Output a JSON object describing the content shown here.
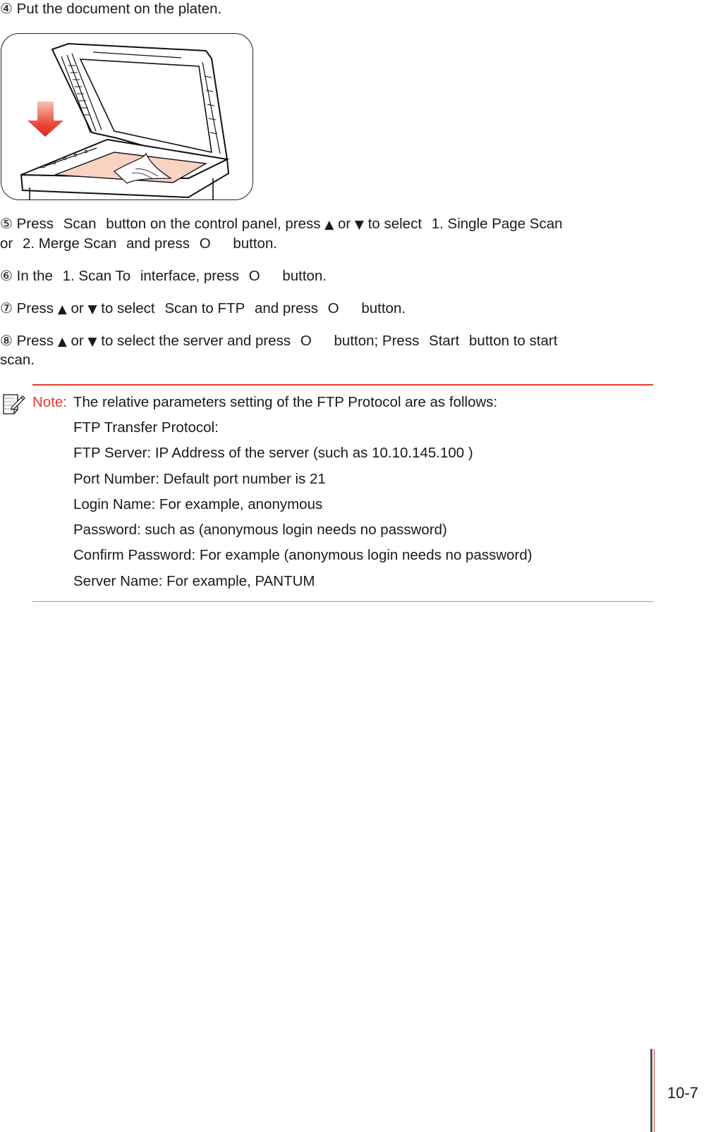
{
  "steps": [
    {
      "marker": "④",
      "lines": [
        {
          "text": "Put the document on the platen."
        }
      ]
    },
    {
      "marker": "⑤",
      "line1": {
        "press": "Press",
        "key_scan": "Scan",
        "t1": "button on the control panel, press",
        "up": "▲",
        "or": "or",
        "down": "▼",
        "t2": "to select",
        "option1": "1. Single Page Scan"
      },
      "line2": {
        "or": "or",
        "option2": "2. Merge Scan",
        "t1": "and press",
        "ok": "O",
        "t2": "button."
      }
    },
    {
      "marker": "⑥",
      "line1": {
        "t0": "In the",
        "menu": "1. Scan To",
        "t1": "interface, press",
        "ok": "O",
        "t2": "button."
      }
    },
    {
      "marker": "⑦",
      "line1": {
        "press": "Press",
        "up": "▲",
        "or": "or",
        "down": "▼",
        "t1": "to select",
        "option": "Scan to FTP",
        "t2": "and press",
        "ok": "O",
        "t3": "button."
      }
    },
    {
      "marker": "⑧",
      "line1": {
        "press": "Press",
        "up": "▲",
        "or": "or",
        "down": "▼",
        "t1": "to select the server and press",
        "ok": "O",
        "t2": "button; Press",
        "start": "Start",
        "t3": "button to start"
      },
      "line2": {
        "t": "scan."
      }
    }
  ],
  "figure": {
    "description": "Scanner with open lid, document placed on the platen glass, red arrow pointing down",
    "arrow_color": "#e5362a",
    "document_color": "#f8d3c2"
  },
  "note": {
    "icon": "note-pencil-icon",
    "label": "Note:",
    "label_color": "#e8392d",
    "lines": [
      "The relative parameters setting of the FTP Protocol are as follows:",
      "FTP Transfer Protocol:",
      "FTP Server: IP Address of the server (such as 10.10.145.100 )",
      "Port Number: Default port number is 21",
      "Login Name: For example, anonymous",
      "Password: such as (anonymous login needs no password)",
      "Confirm Password: For example (anonymous login needs no password)",
      "Server Name: For example, PANTUM"
    ]
  },
  "footer": {
    "page_number": "10-7"
  }
}
